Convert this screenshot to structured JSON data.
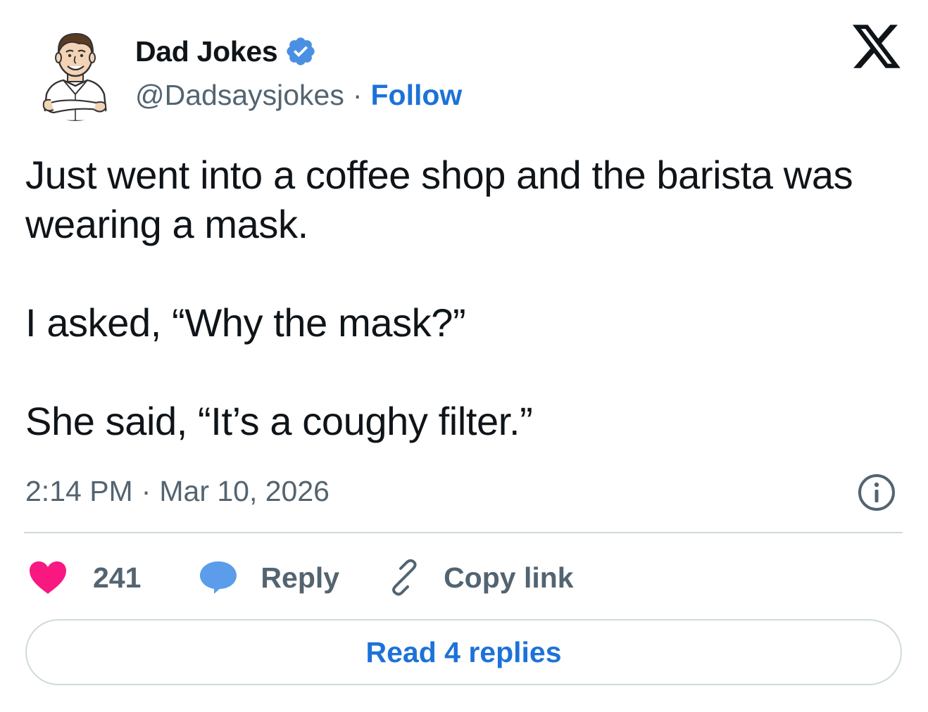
{
  "author": {
    "display_name": "Dad Jokes",
    "handle": "@Dadsaysjokes",
    "separator": "·",
    "follow_label": "Follow",
    "verified": true
  },
  "tweet": {
    "paragraphs": [
      "Just went into a coffee shop and the barista was wearing a mask.",
      "I asked, “Why the mask?”",
      "She said, “It’s a coughy filter.”"
    ],
    "time": "2:14 PM",
    "separator": "·",
    "date": "Mar 10, 2026"
  },
  "actions": {
    "like_count": "241",
    "reply_label": "Reply",
    "copy_link_label": "Copy link"
  },
  "read_replies_label": "Read 4 replies",
  "icons": {
    "brand": "x-logo-icon",
    "verified": "verified-badge-icon",
    "like": "heart-icon",
    "reply": "speech-bubble-icon",
    "copy": "link-icon",
    "info": "info-icon"
  },
  "colors": {
    "text_primary": "#0f1419",
    "text_secondary": "#536471",
    "link_blue": "#1d72d8",
    "verified_blue": "#4a90e2",
    "heart_pink": "#f91880",
    "reply_blue": "#5b9dea",
    "border": "#cfd9de"
  }
}
